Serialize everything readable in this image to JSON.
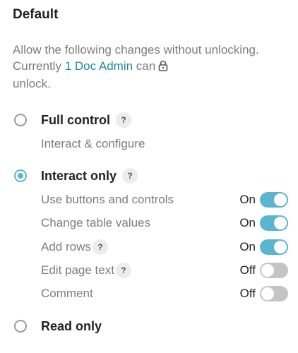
{
  "section": {
    "title": "Default"
  },
  "description": {
    "text_before": "Allow the following changes without unlocking. Currently ",
    "link_text": "1 Doc Admin",
    "text_after": " can",
    "text_end": "unlock.",
    "lock_icon": "lock-icon"
  },
  "options": {
    "full_control": {
      "label": "Full control",
      "subtitle": "Interact & configure",
      "help": "?",
      "checked": false
    },
    "interact_only": {
      "label": "Interact only",
      "help": "?",
      "checked": true
    },
    "read_only": {
      "label": "Read only",
      "checked": false
    }
  },
  "permissions": [
    {
      "label": "Use buttons and controls",
      "state": "On",
      "on": true,
      "help": ""
    },
    {
      "label": "Change table values",
      "state": "On",
      "on": true,
      "help": ""
    },
    {
      "label": "Add rows",
      "state": "On",
      "on": true,
      "help": "?"
    },
    {
      "label": "Edit page text",
      "state": "Off",
      "on": false,
      "help": "?"
    },
    {
      "label": "Comment",
      "state": "Off",
      "on": false,
      "help": ""
    }
  ],
  "colors": {
    "accent": "#5ab6cf",
    "link": "#1f8a9b",
    "toggle_off": "#c4c4c4",
    "muted_text": "#7d7d7d"
  }
}
